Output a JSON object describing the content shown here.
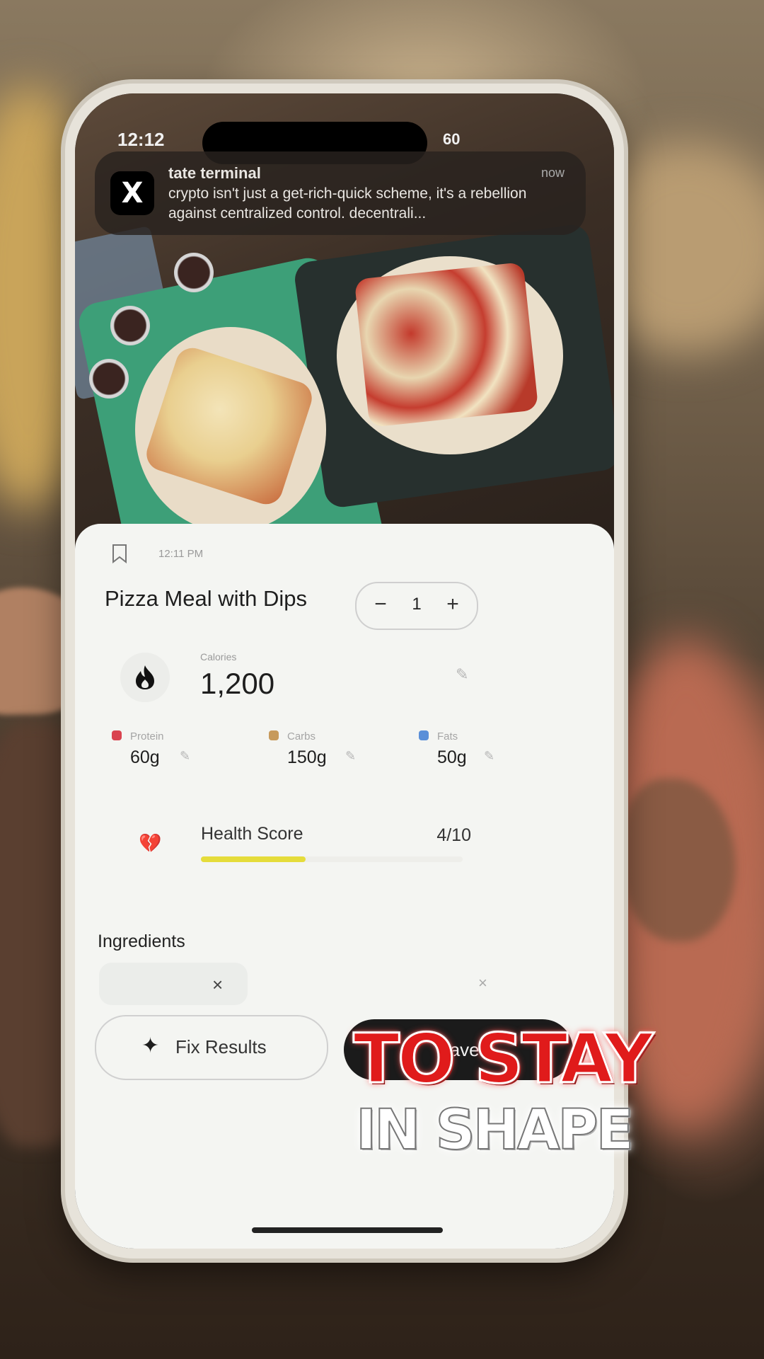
{
  "status_bar": {
    "time": "12:12",
    "right": "60"
  },
  "notification": {
    "app_icon": "x-logo-icon",
    "title": "tate terminal",
    "time": "now",
    "body": "crypto isn't just a get-rich-quick scheme, it's a rebellion against centralized control. decentrali..."
  },
  "card": {
    "time": "12:11 PM",
    "meal_title": "Pizza Meal with Dips",
    "quantity": {
      "minus": "−",
      "value": "1",
      "plus": "+"
    },
    "calories": {
      "label": "Calories",
      "value": "1,200"
    },
    "macros": [
      {
        "label": "Protein",
        "value": "60g",
        "color": "#d9434f"
      },
      {
        "label": "Carbs",
        "value": "150g",
        "color": "#c79a5b"
      },
      {
        "label": "Fats",
        "value": "50g",
        "color": "#5a8fd8"
      }
    ],
    "health": {
      "label": "Health Score",
      "score": "4/10",
      "fraction": 0.4,
      "bar_color": "#e5dc3a"
    },
    "ingredients_label": "Ingredients",
    "fix_button": "Fix Results",
    "save_button": "Save"
  },
  "caption": {
    "line1": "TO STAY",
    "line2": "IN SHAPE"
  }
}
